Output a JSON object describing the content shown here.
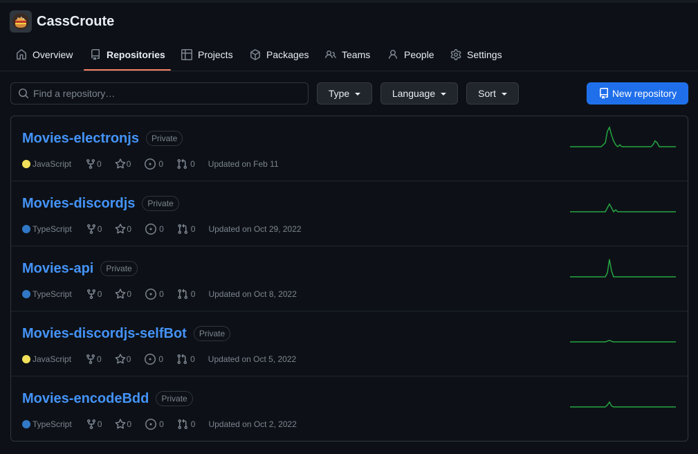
{
  "org": {
    "name": "CassCroute"
  },
  "nav": [
    {
      "label": "Overview",
      "icon": "home-icon",
      "selected": false
    },
    {
      "label": "Repositories",
      "icon": "repo-icon",
      "selected": true
    },
    {
      "label": "Projects",
      "icon": "table-icon",
      "selected": false
    },
    {
      "label": "Packages",
      "icon": "package-icon",
      "selected": false
    },
    {
      "label": "Teams",
      "icon": "people-icon",
      "selected": false
    },
    {
      "label": "People",
      "icon": "person-icon",
      "selected": false
    },
    {
      "label": "Settings",
      "icon": "gear-icon",
      "selected": false
    }
  ],
  "search": {
    "placeholder": "Find a repository…",
    "value": ""
  },
  "filters": {
    "type": "Type",
    "language": "Language",
    "sort": "Sort"
  },
  "new_repo_label": "New repository",
  "colors": {
    "accent": "#4493f8",
    "selected_underline": "#f78166",
    "primary_button": "#1f6feb",
    "sparkline": "#26a641",
    "javascript": "#f1e05a",
    "typescript": "#3178c6"
  },
  "repos": [
    {
      "name": "Movies-electronjs",
      "visibility": "Private",
      "language": "JavaScript",
      "language_color": "#f1e05a",
      "forks": "0",
      "stars": "0",
      "issues": "0",
      "pulls": "0",
      "updated": "Updated on Feb 11",
      "activity": [
        0,
        0,
        0,
        0,
        0,
        0,
        0,
        0,
        0,
        0,
        0,
        0,
        0,
        0,
        0,
        0,
        1,
        2,
        8,
        10,
        6,
        3,
        1,
        0,
        1,
        0,
        0,
        0,
        0,
        0,
        0,
        0,
        0,
        0,
        0,
        0,
        0,
        0,
        0,
        0,
        1,
        3,
        2,
        0,
        0,
        0,
        0,
        0,
        0,
        0,
        0,
        0
      ]
    },
    {
      "name": "Movies-discordjs",
      "visibility": "Private",
      "language": "TypeScript",
      "language_color": "#3178c6",
      "forks": "0",
      "stars": "0",
      "issues": "0",
      "pulls": "0",
      "updated": "Updated on Oct 29, 2022",
      "activity": [
        0,
        0,
        0,
        0,
        0,
        0,
        0,
        0,
        0,
        0,
        0,
        0,
        0,
        0,
        0,
        0,
        0,
        0,
        2,
        4,
        2,
        0,
        1,
        0,
        0,
        0,
        0,
        0,
        0,
        0,
        0,
        0,
        0,
        0,
        0,
        0,
        0,
        0,
        0,
        0,
        0,
        0,
        0,
        0,
        0,
        0,
        0,
        0,
        0,
        0,
        0,
        0
      ]
    },
    {
      "name": "Movies-api",
      "visibility": "Private",
      "language": "TypeScript",
      "language_color": "#3178c6",
      "forks": "0",
      "stars": "0",
      "issues": "0",
      "pulls": "0",
      "updated": "Updated on Oct 8, 2022",
      "activity": [
        0,
        0,
        0,
        0,
        0,
        0,
        0,
        0,
        0,
        0,
        0,
        0,
        0,
        0,
        0,
        0,
        0,
        0,
        2,
        9,
        3,
        0,
        0,
        0,
        0,
        0,
        0,
        0,
        0,
        0,
        0,
        0,
        0,
        0,
        0,
        0,
        0,
        0,
        0,
        0,
        0,
        0,
        0,
        0,
        0,
        0,
        0,
        0,
        0,
        0,
        0,
        0
      ]
    },
    {
      "name": "Movies-discordjs-selfBot",
      "visibility": "Private",
      "language": "JavaScript",
      "language_color": "#f1e05a",
      "forks": "0",
      "stars": "0",
      "issues": "0",
      "pulls": "0",
      "updated": "Updated on Oct 5, 2022",
      "activity": [
        0,
        0,
        0,
        0,
        0,
        0,
        0,
        0,
        0,
        0,
        0,
        0,
        0,
        0,
        0,
        0,
        0,
        0,
        0.4,
        0.8,
        0.3,
        0,
        0,
        0,
        0,
        0,
        0,
        0,
        0,
        0,
        0,
        0,
        0,
        0,
        0,
        0,
        0,
        0,
        0,
        0,
        0,
        0,
        0,
        0,
        0,
        0,
        0,
        0,
        0,
        0,
        0,
        0
      ]
    },
    {
      "name": "Movies-encodeBdd",
      "visibility": "Private",
      "language": "TypeScript",
      "language_color": "#3178c6",
      "forks": "0",
      "stars": "0",
      "issues": "0",
      "pulls": "0",
      "updated": "Updated on Oct 2, 2022",
      "activity": [
        0,
        0,
        0,
        0,
        0,
        0,
        0,
        0,
        0,
        0,
        0,
        0,
        0,
        0,
        0,
        0,
        0,
        0,
        1,
        2.5,
        0.5,
        0,
        0,
        0,
        0,
        0,
        0,
        0,
        0,
        0,
        0,
        0,
        0,
        0,
        0,
        0,
        0,
        0,
        0,
        0,
        0,
        0,
        0,
        0,
        0,
        0,
        0,
        0,
        0,
        0,
        0,
        0
      ]
    }
  ]
}
